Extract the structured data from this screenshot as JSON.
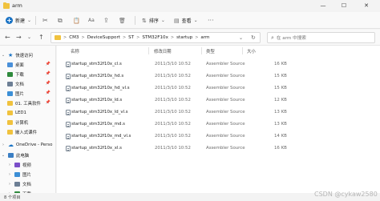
{
  "window": {
    "title": "arm",
    "minimize": "—",
    "maximize": "☐",
    "close": "✕"
  },
  "toolbar": {
    "new_label": "新建",
    "new_chevron": "⌄",
    "cut": "✂",
    "copy": "⧉",
    "paste": "📋",
    "rename": "Aa",
    "share": "⇪",
    "delete": "🗑",
    "sort_label": "排序",
    "view_label": "查看",
    "more": "···"
  },
  "nav": {
    "back": "←",
    "forward": "→",
    "recent": "⌄",
    "up": "↑"
  },
  "address": {
    "crumbs": [
      "CM3",
      "DeviceSupport",
      "ST",
      "STM32F10x",
      "startup",
      "arm"
    ],
    "separator": ">",
    "dropdown": "⌄",
    "refresh": "↻"
  },
  "search": {
    "placeholder": "在 arm 中搜索",
    "icon": "⌕"
  },
  "sidebar": {
    "quick_access": "快速访问",
    "items": [
      {
        "label": "桌面",
        "pinned": true,
        "color": "#4a90d9"
      },
      {
        "label": "下载",
        "pinned": true,
        "color": "#2f8a3d"
      },
      {
        "label": "文档",
        "pinned": true,
        "color": "#6d7f95"
      },
      {
        "label": "图片",
        "pinned": true,
        "color": "#3c8fd6"
      },
      {
        "label": "01. 工具软件",
        "pinned": true,
        "color": "#f0c23e"
      },
      {
        "label": "LED1",
        "pinned": false,
        "color": "#f0c23e"
      },
      {
        "label": "计算机",
        "pinned": false,
        "color": "#f0c23e"
      },
      {
        "label": "嵌入式课件",
        "pinned": false,
        "color": "#f0c23e"
      }
    ],
    "onedrive": "OneDrive - Perso",
    "this_pc": "此电脑",
    "pc_items": [
      {
        "label": "视频",
        "color": "#7b4fc9"
      },
      {
        "label": "图片",
        "color": "#3c8fd6"
      },
      {
        "label": "文档",
        "color": "#6d7f95"
      },
      {
        "label": "下载",
        "color": "#2f8a3d"
      }
    ],
    "pin_glyph": "📌"
  },
  "columns": {
    "name": "名称",
    "date": "修改日期",
    "type": "类型",
    "size": "大小"
  },
  "files": [
    {
      "name": "startup_stm32f10x_cl.s",
      "date": "2011/3/10 10:52",
      "type": "Assembler Source",
      "size": "16 KB"
    },
    {
      "name": "startup_stm32f10x_hd.s",
      "date": "2011/3/10 10:52",
      "type": "Assembler Source",
      "size": "15 KB"
    },
    {
      "name": "startup_stm32f10x_hd_vl.s",
      "date": "2011/3/10 10:52",
      "type": "Assembler Source",
      "size": "15 KB"
    },
    {
      "name": "startup_stm32f10x_ld.s",
      "date": "2011/3/10 10:52",
      "type": "Assembler Source",
      "size": "12 KB"
    },
    {
      "name": "startup_stm32f10x_ld_vl.s",
      "date": "2011/3/10 10:52",
      "type": "Assembler Source",
      "size": "13 KB"
    },
    {
      "name": "startup_stm32f10x_md.s",
      "date": "2011/3/10 10:52",
      "type": "Assembler Source",
      "size": "13 KB"
    },
    {
      "name": "startup_stm32f10x_md_vl.s",
      "date": "2011/3/10 10:52",
      "type": "Assembler Source",
      "size": "14 KB"
    },
    {
      "name": "startup_stm32f10x_xl.s",
      "date": "2011/3/10 10:52",
      "type": "Assembler Source",
      "size": "16 KB"
    }
  ],
  "status": {
    "text": "8 个项目"
  },
  "watermark": "CSDN @cykaw2580",
  "colors": {
    "accent": "#1a73c4",
    "folder": "#f0c23e"
  }
}
